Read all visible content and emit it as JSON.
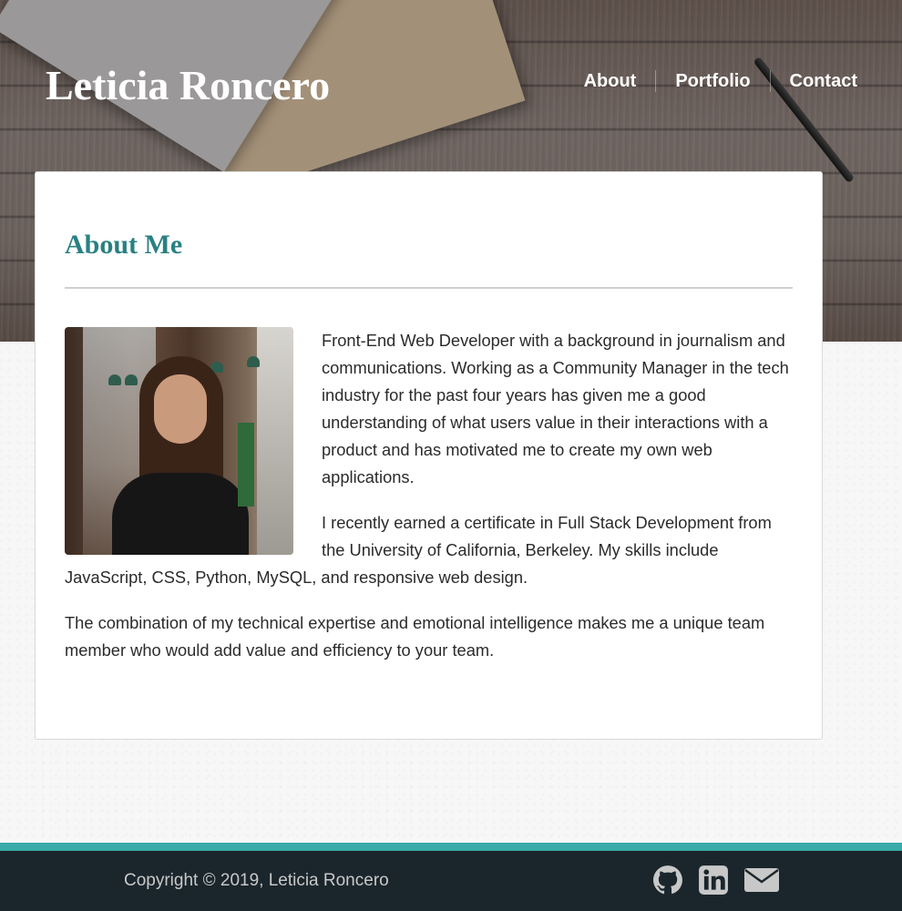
{
  "header": {
    "site_title": "Leticia Roncero",
    "nav": [
      {
        "label": "About"
      },
      {
        "label": "Portfolio"
      },
      {
        "label": "Contact"
      }
    ]
  },
  "about": {
    "heading": "About Me",
    "paragraphs": [
      "Front-End Web Developer with a background in journalism and communications. Working as a Community Manager in the tech industry for the past four years has given me a good understanding of what users value in their interactions with a product and has motivated me to create my own web applications.",
      "I recently earned a certificate in Full Stack Development from the University of California, Berkeley. My skills include JavaScript, CSS, Python, MySQL, and responsive web design.",
      "The combination of my technical expertise and emotional intelligence makes me a unique team member who would add value and efficiency to your team."
    ]
  },
  "footer": {
    "copyright": "Copyright © 2019, Leticia Roncero",
    "social_icons": [
      "github-icon",
      "linkedin-icon",
      "envelope-icon"
    ]
  },
  "colors": {
    "heading_accent": "#2a8082",
    "footer_accent": "#39aba9",
    "footer_background": "#1b262c"
  }
}
